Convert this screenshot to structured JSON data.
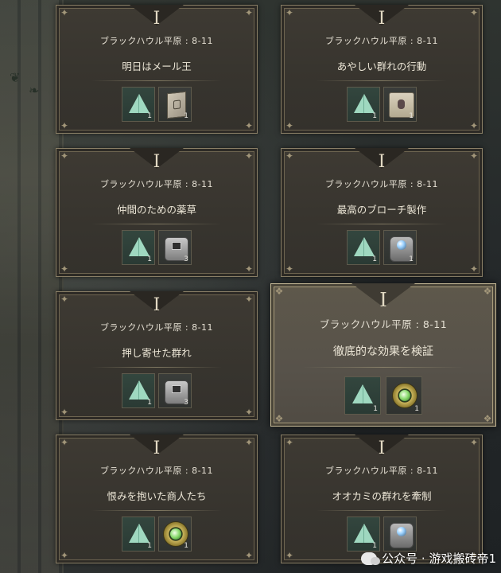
{
  "quest_board": {
    "cards": [
      {
        "numeral": "I",
        "location": "ブラックハウル平原 : 8-11",
        "title": "明日はメール王",
        "rewards": [
          {
            "icon": "tent-icon",
            "count": "1"
          },
          {
            "icon": "book-icon",
            "count": "1"
          }
        ]
      },
      {
        "numeral": "I",
        "location": "ブラックハウル平原 : 8-11",
        "title": "あやしい群れの行動",
        "rewards": [
          {
            "icon": "tent-icon",
            "count": "1"
          },
          {
            "icon": "scroll-icon",
            "count": "1"
          }
        ]
      },
      {
        "numeral": "I",
        "location": "ブラックハウル平原 : 8-11",
        "title": "仲間のための薬草",
        "rewards": [
          {
            "icon": "tent-icon",
            "count": "1"
          },
          {
            "icon": "box-icon",
            "count": "3"
          }
        ]
      },
      {
        "numeral": "I",
        "location": "ブラックハウル平原 : 8-11",
        "title": "最高のブローチ製作",
        "rewards": [
          {
            "icon": "tent-icon",
            "count": "1"
          },
          {
            "icon": "brooch-icon",
            "count": "1"
          }
        ]
      },
      {
        "numeral": "I",
        "location": "ブラックハウル平原 : 8-11",
        "title": "押し寄せた群れ",
        "rewards": [
          {
            "icon": "tent-icon",
            "count": "1"
          },
          {
            "icon": "box-icon",
            "count": "3"
          }
        ]
      },
      {
        "numeral": "I",
        "location": "ブラックハウル平原 : 8-11",
        "title": "徹底的な効果を検証",
        "selected": true,
        "rewards": [
          {
            "icon": "tent-icon",
            "count": "1"
          },
          {
            "icon": "ring-icon",
            "count": "1"
          }
        ]
      },
      {
        "numeral": "I",
        "location": "ブラックハウル平原 : 8-11",
        "title": "恨みを抱いた商人たち",
        "rewards": [
          {
            "icon": "tent-icon",
            "count": "1"
          },
          {
            "icon": "ring-icon",
            "count": "1"
          }
        ]
      },
      {
        "numeral": "I",
        "location": "ブラックハウル平原 : 8-11",
        "title": "オオカミの群れを牽制",
        "rewards": [
          {
            "icon": "tent-icon",
            "count": "1"
          },
          {
            "icon": "brooch-icon",
            "count": ""
          }
        ]
      }
    ]
  },
  "watermark": {
    "text": "公众号 · 游戏搬砖帝1"
  },
  "colors": {
    "card_bg": "#3a362f",
    "card_border": "#8a7f66",
    "selected_bg": "#57524a",
    "selected_border": "#c9bc98",
    "text": "#ece6d6"
  }
}
